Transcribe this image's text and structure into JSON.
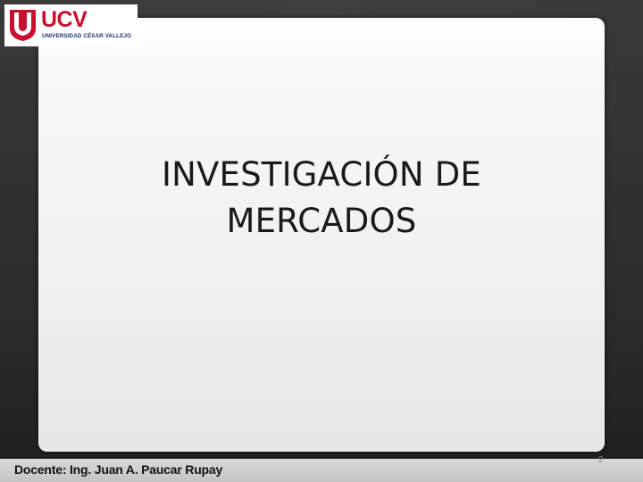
{
  "logo": {
    "title": "UCV",
    "subtitle": "UNIVERSIDAD CÉSAR VALLEJO",
    "brand_red": "#c8102e",
    "brand_blue": "#1f2f6e"
  },
  "slide": {
    "title_line1": "INVESTIGACIÓN DE",
    "title_line2": "MERCADOS",
    "page_number": "2"
  },
  "footer": {
    "text": "Docente: Ing. Juan A. Paucar Rupay"
  }
}
